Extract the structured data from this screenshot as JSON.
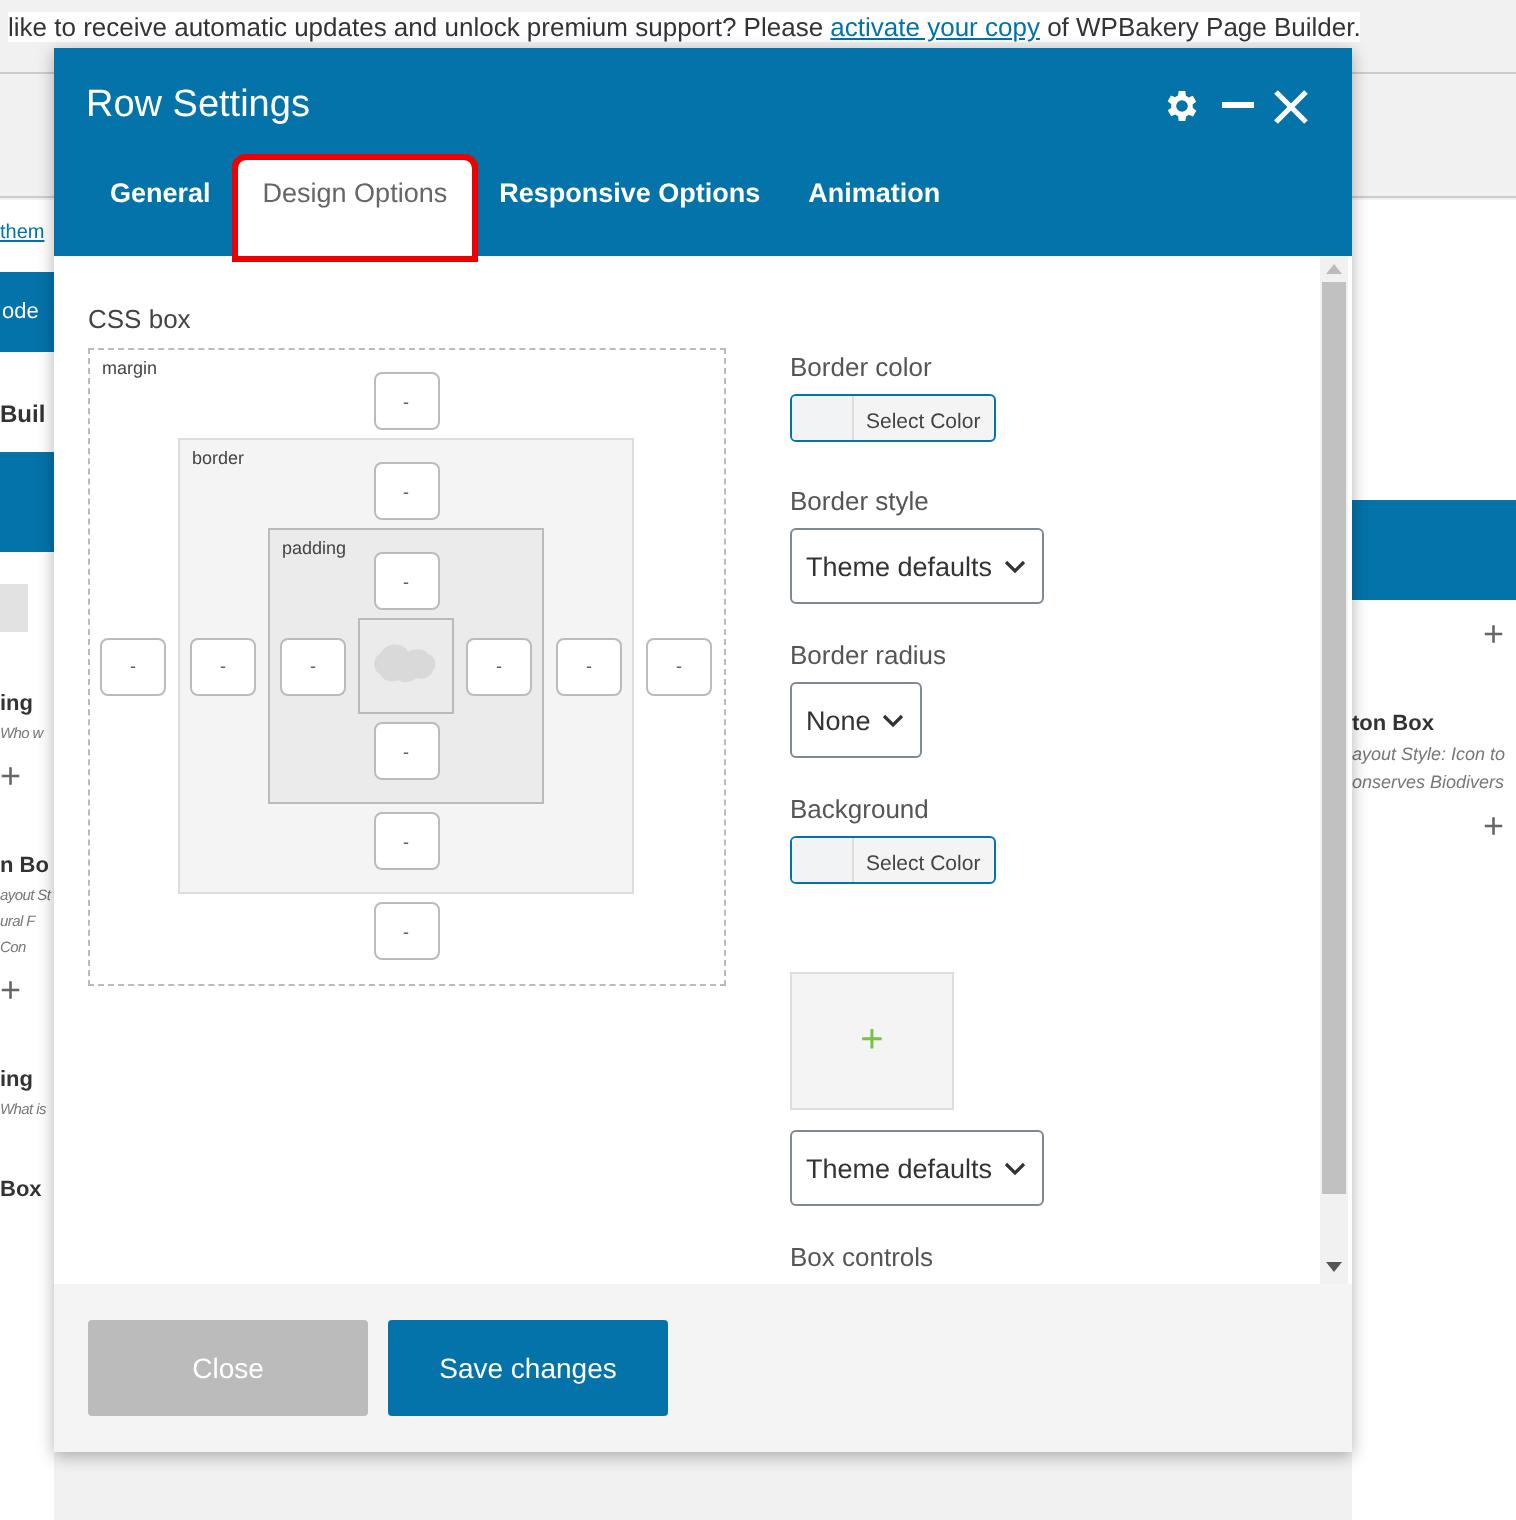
{
  "notice": {
    "before": "like to receive automatic updates and unlock premium support? Please",
    "link": "activate your copy",
    "after": "of WPBakery Page Builder."
  },
  "background_left": [
    {
      "kind": "link",
      "text": "them"
    },
    {
      "kind": "button",
      "text": "ode"
    },
    {
      "kind": "heading",
      "text": "Buil"
    },
    {
      "kind": "bar"
    },
    {
      "kind": "tab"
    },
    {
      "kind": "title",
      "text": "ing"
    },
    {
      "kind": "desc",
      "text": "Who w"
    },
    {
      "kind": "plus",
      "text": "+"
    },
    {
      "kind": "title",
      "text": "n Bo"
    },
    {
      "kind": "desc",
      "text": "ayout St"
    },
    {
      "kind": "desc",
      "text": "ural F"
    },
    {
      "kind": "desc",
      "text": "Con"
    },
    {
      "kind": "plus",
      "text": "+"
    },
    {
      "kind": "title",
      "text": "ing"
    },
    {
      "kind": "desc",
      "text": "What is"
    },
    {
      "kind": "title",
      "text": "Box"
    }
  ],
  "background_right": [
    {
      "kind": "bar"
    },
    {
      "kind": "plus",
      "text": "+"
    },
    {
      "kind": "title",
      "text": "ton Box"
    },
    {
      "kind": "desc",
      "text": "ayout Style: Icon to"
    },
    {
      "kind": "desc",
      "text": "onserves Biodivers"
    },
    {
      "kind": "plus",
      "text": "+"
    }
  ],
  "dialog": {
    "title": "Row Settings",
    "tabs": [
      {
        "label": "General",
        "selected": false,
        "highlighted": false
      },
      {
        "label": "Design Options",
        "selected": true,
        "highlighted": true
      },
      {
        "label": "Responsive Options",
        "selected": false,
        "highlighted": false
      },
      {
        "label": "Animation",
        "selected": false,
        "highlighted": false
      }
    ],
    "css_box": {
      "title": "CSS box",
      "layers": [
        {
          "label": "margin",
          "fields": [
            {
              "kind": "top",
              "placeholder": "-"
            },
            {
              "kind": "left",
              "placeholder": "-"
            },
            {
              "kind": "right",
              "placeholder": "-"
            },
            {
              "kind": "bottom",
              "placeholder": "-"
            }
          ]
        },
        {
          "label": "border",
          "fields": [
            {
              "kind": "top",
              "placeholder": "-"
            },
            {
              "kind": "left",
              "placeholder": "-"
            },
            {
              "kind": "right",
              "placeholder": "-"
            },
            {
              "kind": "bottom",
              "placeholder": "-"
            }
          ]
        },
        {
          "label": "padding",
          "fields": [
            {
              "kind": "top",
              "placeholder": "-"
            },
            {
              "kind": "left",
              "placeholder": "-"
            },
            {
              "kind": "right",
              "placeholder": "-"
            },
            {
              "kind": "bottom",
              "placeholder": "-"
            }
          ]
        }
      ]
    },
    "fields": [
      {
        "kind": "color",
        "label": "Border color",
        "button": "Select Color"
      },
      {
        "kind": "select",
        "label": "Border style",
        "value": "Theme defaults"
      },
      {
        "kind": "select",
        "label": "Border radius",
        "value": "None"
      },
      {
        "kind": "color",
        "label": "Background",
        "button": "Select Color"
      },
      {
        "kind": "image",
        "plus": "+"
      },
      {
        "kind": "select",
        "value": "Theme defaults"
      },
      {
        "kind": "heading",
        "label": "Box controls"
      }
    ],
    "buttons": [
      {
        "label": "Close",
        "kind": "secondary"
      },
      {
        "label": "Save changes",
        "kind": "primary"
      }
    ]
  }
}
